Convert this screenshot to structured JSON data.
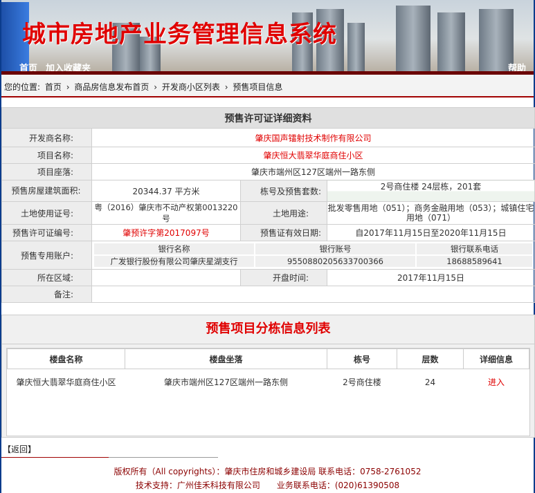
{
  "header": {
    "title": "城市房地产业务管理信息系统",
    "nav": [
      "首页",
      "加入收藏夹"
    ],
    "help": "帮助"
  },
  "breadcrumb": {
    "prefix": "您的位置:",
    "items": [
      "首页",
      "商品房信息发布首页",
      "开发商小区列表",
      "预售项目信息"
    ],
    "separator": "›"
  },
  "detail": {
    "title": "预售许可证详细资料",
    "developer_label": "开发商名称:",
    "developer": "肇庆国声镭射技术制作有限公司",
    "project_label": "项目名称:",
    "project": "肇庆恒大翡翠华庭商住小区",
    "location_label": "项目座落:",
    "location": "肇庆市端州区127区端州一路东侧",
    "area_label": "预售房屋建筑面积:",
    "area": "20344.37 平方米",
    "building_label": "栋号及预售套数:",
    "building": "2号商住楼 24层栋，201套",
    "land_cert_label": "土地使用证号:",
    "land_cert": "粤（2016）肇庆市不动产权第0013220号",
    "land_use_label": "土地用途:",
    "land_use": "批发零售用地（051）；商务金融用地（053）；城镇住宅用地（071）",
    "permit_label": "预售许可证编号:",
    "permit": "肇预许字第2017097号",
    "valid_label": "预售证有效日期:",
    "valid": "自2017年11月15日至2020年11月15日",
    "account_label": "预售专用账户:",
    "bank_headers": [
      "银行名称",
      "银行账号",
      "银行联系电话"
    ],
    "bank": {
      "name": "广发银行股份有限公司肇庆星湖支行",
      "account": "9550880205633700366",
      "phone": "18688589641"
    },
    "district_label": "所在区域:",
    "district": "",
    "open_label": "开盘时间:",
    "open": "2017年11月15日",
    "remark_label": "备注:",
    "remark": ""
  },
  "buildings": {
    "title": "预售项目分栋信息列表",
    "headers": [
      "楼盘名称",
      "楼盘坐落",
      "栋号",
      "层数",
      "详细信息"
    ],
    "rows": [
      {
        "name": "肇庆恒大翡翠华庭商住小区",
        "location": "肇庆市端州区127区端州一路东侧",
        "building": "2号商住楼",
        "floors": "24",
        "link": "进入"
      }
    ]
  },
  "back": "【返回】",
  "footer": {
    "line1": "版权所有（All copyrights）：肇庆市住房和城乡建设局 联系电话：0758-2761052",
    "line2": "技术支持：广州佳禾科技有限公司　　业务联系电话：(020)61390508"
  }
}
